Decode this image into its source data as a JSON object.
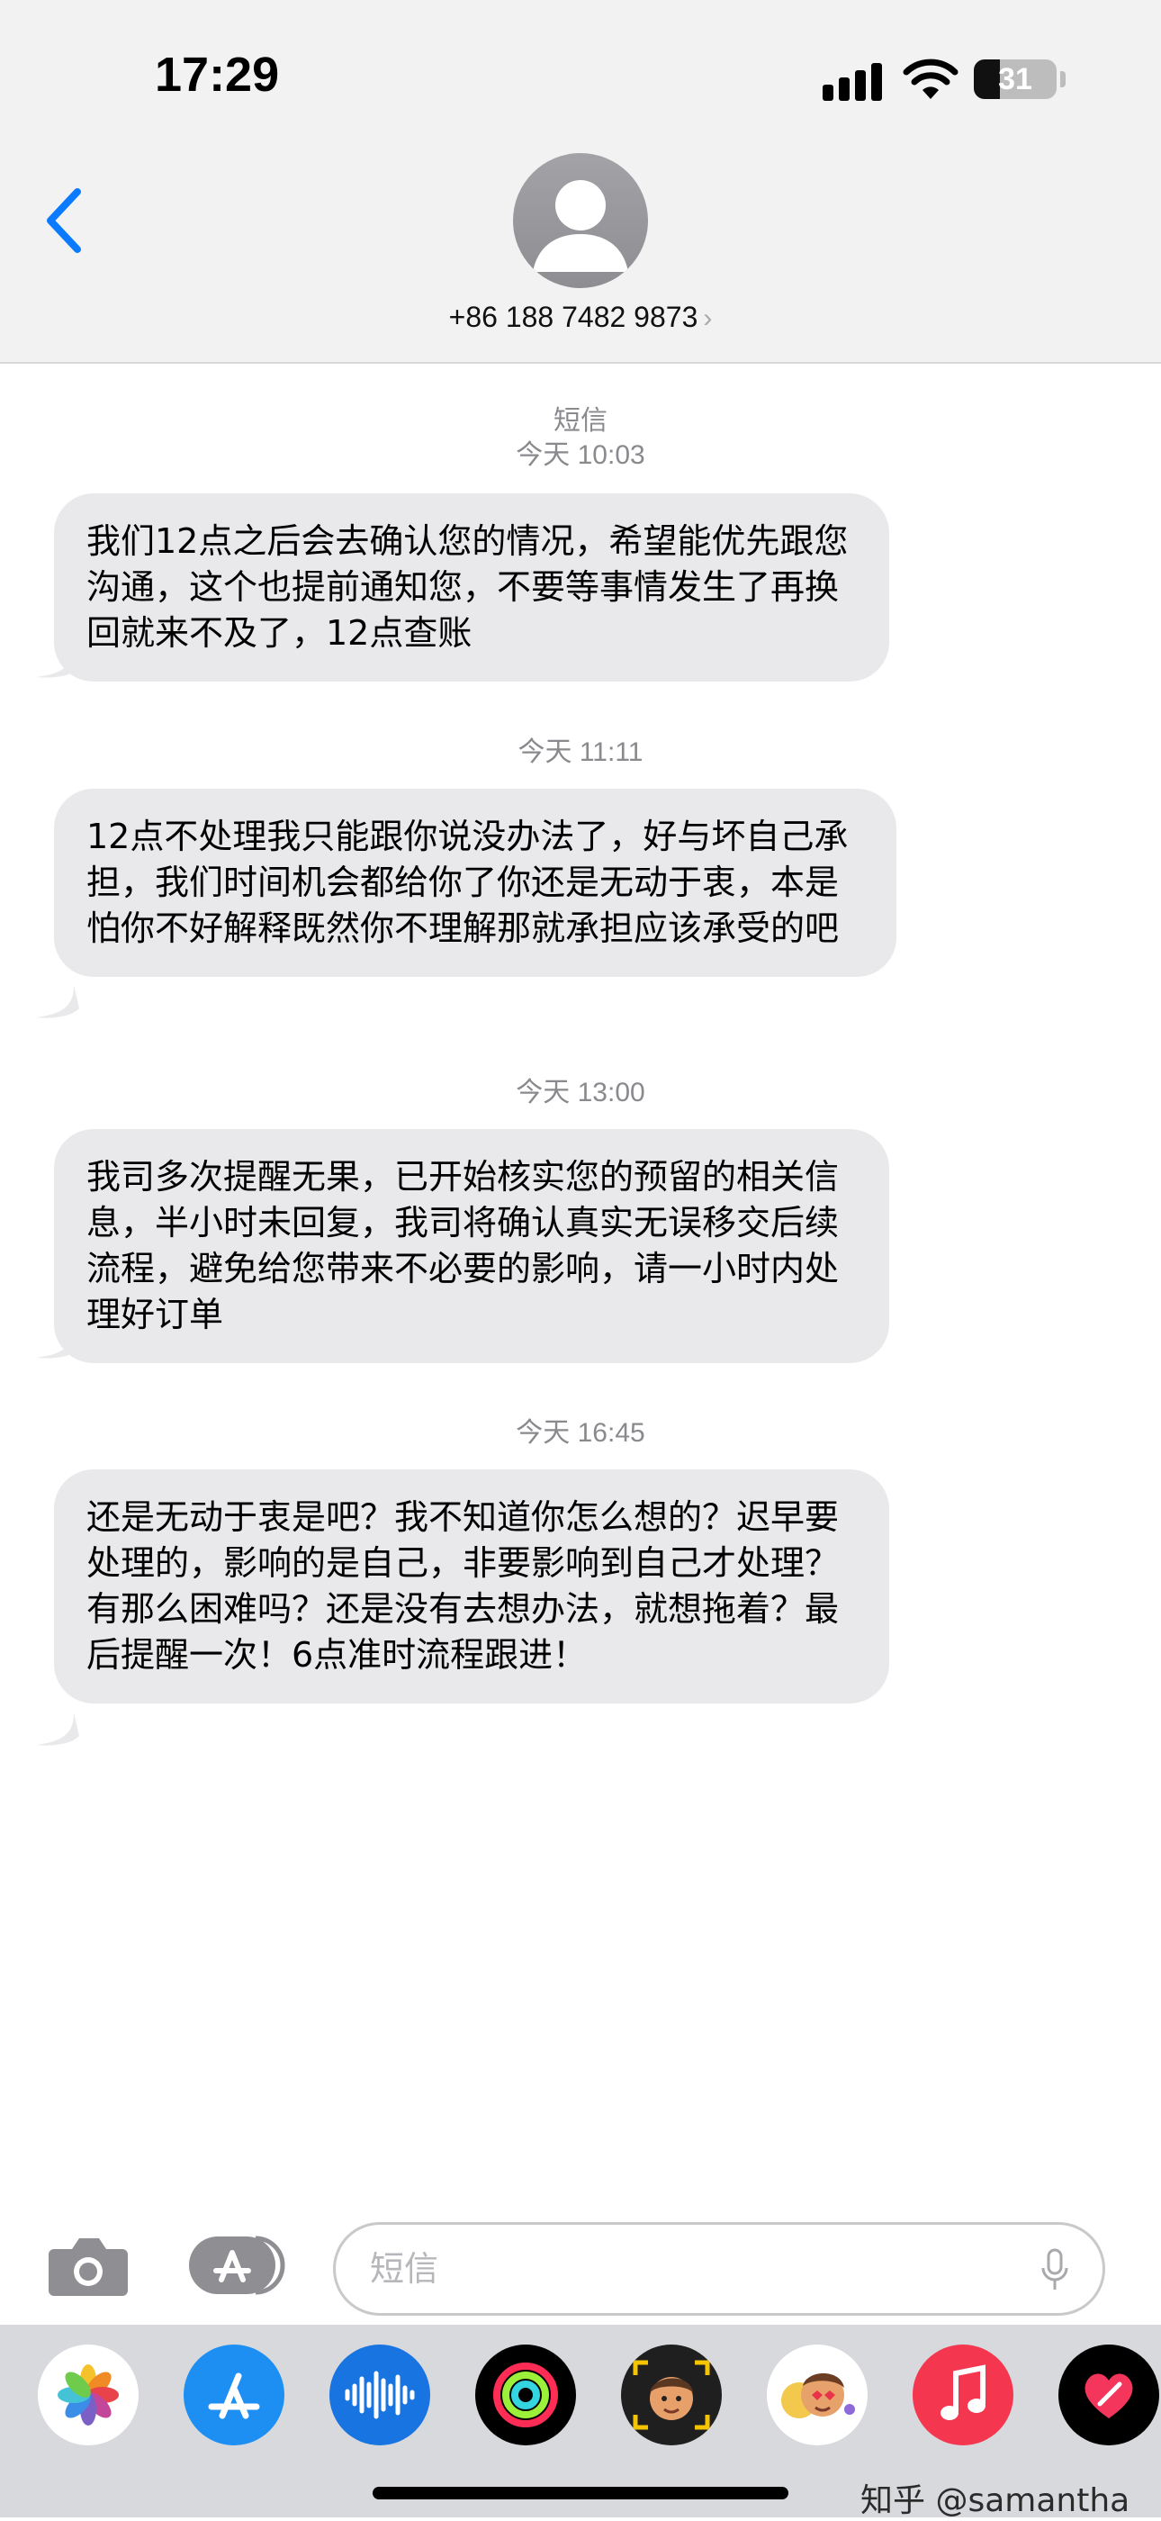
{
  "status_bar": {
    "time": "17:29",
    "battery": "31",
    "battery_level": 0.31
  },
  "header": {
    "contact": "+86 188 7482 9873",
    "chevron": "›"
  },
  "conversation": {
    "service_label": "短信",
    "messages": [
      {
        "timestamp": "今天 10:03",
        "text": "我们12点之后会去确认您的情况，希望能优先跟您沟通，这个也提前通知您，不要等事情发生了再换回就来不及了，12点查账"
      },
      {
        "timestamp": "今天 11:11",
        "text": "12点不处理我只能跟你说没办法了，好与坏自己承担，我们时间机会都给你了你还是无动于衷，本是怕你不好解释既然你不理解那就承担应该承受的吧"
      },
      {
        "timestamp": "今天 13:00",
        "text": "我司多次提醒无果，已开始核实您的预留的相关信息，半小时未回复，我司将确认真实无误移交后续流程，避免给您带来不必要的影响，请一小时内处理好订单"
      },
      {
        "timestamp": "今天 16:45",
        "text": "还是无动于衷是吧？我不知道你怎么想的？迟早要处理的，影响的是自己，非要影响到自己才处理？有那么困难吗？还是没有去想办法，就想拖着？最后提醒一次！6点准时流程跟进！"
      }
    ]
  },
  "composer": {
    "placeholder": "短信"
  },
  "app_drawer": {
    "apps": [
      {
        "icon": "photos-icon"
      },
      {
        "icon": "app-store-icon"
      },
      {
        "icon": "audio-message-icon"
      },
      {
        "icon": "fitness-icon"
      },
      {
        "icon": "memoji-icon"
      },
      {
        "icon": "memoji-stickers-icon"
      },
      {
        "icon": "music-icon"
      },
      {
        "icon": "digital-touch-icon"
      }
    ]
  },
  "watermark": "知乎 @samantha",
  "colors": {
    "accent": "#0a7aff",
    "bubble": "#e9e9eb",
    "header": "#f2f2f2",
    "drawer": "#d8d9dd"
  }
}
